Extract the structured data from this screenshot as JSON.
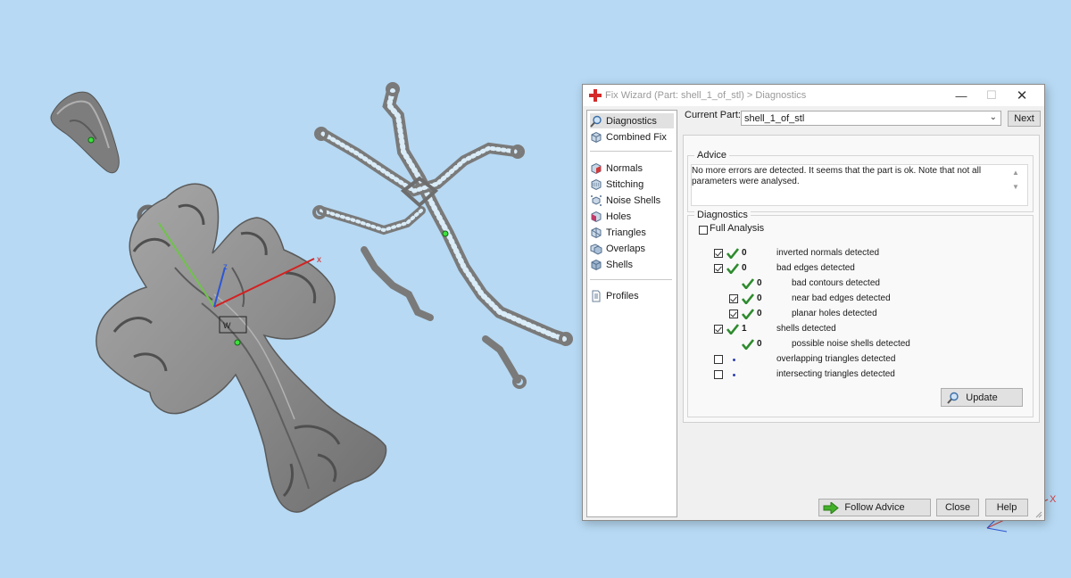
{
  "dialog": {
    "title": "Fix Wizard (Part: shell_1_of_stl) > Diagnostics",
    "min_glyph": "—",
    "max_glyph": "☐",
    "close_glyph": "✕"
  },
  "nav": {
    "items": [
      {
        "label": "Diagnostics",
        "icon": "magnifier-icon",
        "selected": true
      },
      {
        "label": "Combined Fix",
        "icon": "cube-icon",
        "selected": false
      },
      {
        "label": "Normals",
        "icon": "normals-cube-icon",
        "selected": false
      },
      {
        "label": "Stitching",
        "icon": "stitching-cube-icon",
        "selected": false
      },
      {
        "label": "Noise Shells",
        "icon": "noise-shells-icon",
        "selected": false
      },
      {
        "label": "Holes",
        "icon": "holes-cube-icon",
        "selected": false
      },
      {
        "label": "Triangles",
        "icon": "triangles-icon",
        "selected": false
      },
      {
        "label": "Overlaps",
        "icon": "overlaps-icon",
        "selected": false
      },
      {
        "label": "Shells",
        "icon": "shells-icon",
        "selected": false
      },
      {
        "label": "Profiles",
        "icon": "profiles-page-icon",
        "selected": false
      }
    ]
  },
  "current_part": {
    "label": "Current Part:",
    "value": "shell_1_of_stl",
    "next_label": "Next"
  },
  "advice": {
    "title": "Advice",
    "text": "No more errors are detected. It seems that the part is ok. Note that not all parameters were analysed."
  },
  "diagnostics": {
    "title": "Diagnostics",
    "full_analysis_label": "Full Analysis",
    "full_analysis_checked": false,
    "rows": [
      {
        "checked": true,
        "status": "ok",
        "count": "0",
        "label": "inverted normals detected",
        "level": 0
      },
      {
        "checked": true,
        "status": "ok",
        "count": "0",
        "label": "bad edges detected",
        "level": 0
      },
      {
        "checked": null,
        "status": "ok",
        "count": "0",
        "label": "bad contours detected",
        "level": 1
      },
      {
        "checked": true,
        "status": "ok",
        "count": "0",
        "label": "near bad edges detected",
        "level": 1
      },
      {
        "checked": true,
        "status": "ok",
        "count": "0",
        "label": "planar holes detected",
        "level": 1
      },
      {
        "checked": true,
        "status": "ok",
        "count": "1",
        "label": "shells detected",
        "level": 0
      },
      {
        "checked": null,
        "status": "ok",
        "count": "0",
        "label": "possible noise shells detected",
        "level": 1
      },
      {
        "checked": false,
        "status": "pending",
        "count": "",
        "label": "overlapping triangles detected",
        "level": 0
      },
      {
        "checked": false,
        "status": "pending",
        "count": "",
        "label": "intersecting triangles detected",
        "level": 0
      }
    ],
    "update_label": "Update"
  },
  "footer": {
    "follow_label": "Follow Advice",
    "close_label": "Close",
    "help_label": "Help"
  },
  "viewport": {
    "axis_x_label": "x",
    "axis_z_label": "z",
    "corner_x_label": "X"
  },
  "colors": {
    "background": "#b7d9f3",
    "model": "#8e8e8e",
    "ok_check": "#2e8b2e",
    "app_cross": "#d42a2a"
  }
}
